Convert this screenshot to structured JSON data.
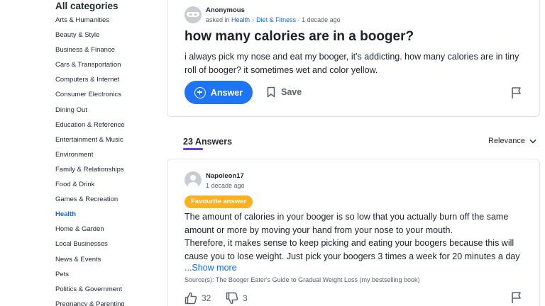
{
  "sidebar": {
    "title": "All categories",
    "items": [
      {
        "label": "Arts & Humanities"
      },
      {
        "label": "Beauty & Style"
      },
      {
        "label": "Business & Finance"
      },
      {
        "label": "Cars & Transportation"
      },
      {
        "label": "Computers & Internet"
      },
      {
        "label": "Consumer Electronics"
      },
      {
        "label": "Dining Out"
      },
      {
        "label": "Education & Reference"
      },
      {
        "label": "Entertainment & Music"
      },
      {
        "label": "Environment"
      },
      {
        "label": "Family & Relationships"
      },
      {
        "label": "Food & Drink"
      },
      {
        "label": "Games & Recreation"
      },
      {
        "label": "Health",
        "active": true
      },
      {
        "label": "Home & Garden"
      },
      {
        "label": "Local Businesses"
      },
      {
        "label": "News & Events"
      },
      {
        "label": "Pets"
      },
      {
        "label": "Politics & Government"
      },
      {
        "label": "Pregnancy & Parenting"
      }
    ]
  },
  "question": {
    "asker": "Anonymous",
    "asked_in": "asked in",
    "category": "Health",
    "subcategory": "Diet & Fitness",
    "time": "· 1 decade ago",
    "title": "how many calories are in a booger?",
    "body": "i always pick my nose and eat my booger, it's addicting. how many calories are in tiny roll of booger? it sometimes wet and color yellow.",
    "answer_label": "Answer",
    "save_label": "Save"
  },
  "answers_header": {
    "count": "23 Answers",
    "sort": "Relevance"
  },
  "answer": {
    "author": "Napoleon17",
    "time": "1 decade ago",
    "badge": "Favourite answer",
    "lines": [
      "The amount of calories in your booger is so low that you actually burn off the same",
      "amount or more by moving your hand from your nose to your mouth.",
      "Therefore, it makes sense to keep picking and eating your boogers because this will",
      "cause you to lose weight. Just pick your boogers 3 times a week for 20 minutes a day"
    ],
    "show_more": "...Show more",
    "source": "Source(s): The Booger Eater's Guide to Gradual Weight Loss (my bestselling book)",
    "upvotes": "32",
    "downvotes": "3"
  },
  "colors": {
    "accent": "#1d74f5",
    "link": "#0f69ff",
    "badge": "#ffb020",
    "underline": "#6e3ae8"
  }
}
